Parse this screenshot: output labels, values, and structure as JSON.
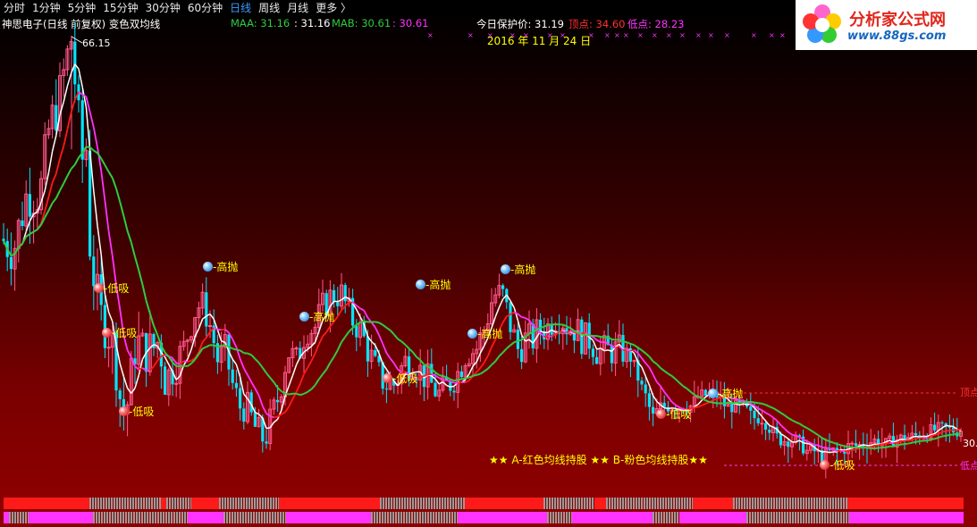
{
  "toolbar": {
    "periods": [
      "分时",
      "1分钟",
      "5分钟",
      "15分钟",
      "30分钟",
      "60分钟",
      "日线",
      "周线",
      "月线"
    ],
    "active_period": "日线",
    "more_label": "更多 〉"
  },
  "info": {
    "stock_title": "神思电子(日线 前复权) 变色双均线",
    "maa_label": "MAA: 31.16",
    "maa_value": ": 31.16",
    "mab_label": "MAB: 30.61",
    "mab_value": ": 30.61",
    "protect_label": "今日保护价: 31.19",
    "top_label": "顶点: 34.60",
    "low_label": "低点: 28.23",
    "date": "2016 年 11 月 24 日"
  },
  "logo": {
    "line1": "分析家公式网",
    "line2": "www.88gs.com"
  },
  "colors": {
    "up_candle": "#ff5a8c",
    "down_candle": "#00e5ff",
    "ma_green": "#2ecc40",
    "ma_white": "#ffffff",
    "ma_red": "#ff1a1a",
    "ma_magenta": "#ff33ff",
    "high_marker": "#3b9bff",
    "low_marker": "#ff3030",
    "signal_text": "#ffff00",
    "bar_red": "#ff1a1a",
    "bar_magenta": "#ff33ff",
    "bar_gray": "#9a9a9a"
  },
  "chart_data": {
    "type": "candlestick",
    "period": "日线",
    "peak_label": "66.15",
    "right_edge_labels": {
      "top": "顶点",
      "price": "30.",
      "low": "低点"
    },
    "legend": "★★ A-红色均线持股 ★★ B-粉色均线持股★★",
    "signals": [
      {
        "type": "low",
        "label": "低吸",
        "price": 44.0
      },
      {
        "type": "low",
        "label": "低吸",
        "price": 37.5
      },
      {
        "type": "low",
        "label": "低吸",
        "price": 31.5
      },
      {
        "type": "high",
        "label": "高抛",
        "price": 42.5
      },
      {
        "type": "high",
        "label": "高抛",
        "price": 38.5
      },
      {
        "type": "high",
        "label": "高抛",
        "price": 40.5
      },
      {
        "type": "low",
        "label": "低吸",
        "price": 34.5
      },
      {
        "type": "high",
        "label": "高抛",
        "price": 37.5
      },
      {
        "type": "high",
        "label": "高抛",
        "price": 42.5
      },
      {
        "type": "high",
        "label": "高抛",
        "price": 33.5
      },
      {
        "type": "low",
        "label": "低吸",
        "price": 31.8
      },
      {
        "type": "low",
        "label": "低吸",
        "price": 28.2
      }
    ],
    "series": [
      {
        "name": "MAA",
        "color": "green"
      },
      {
        "name": "MAB",
        "color": "magenta"
      }
    ]
  }
}
